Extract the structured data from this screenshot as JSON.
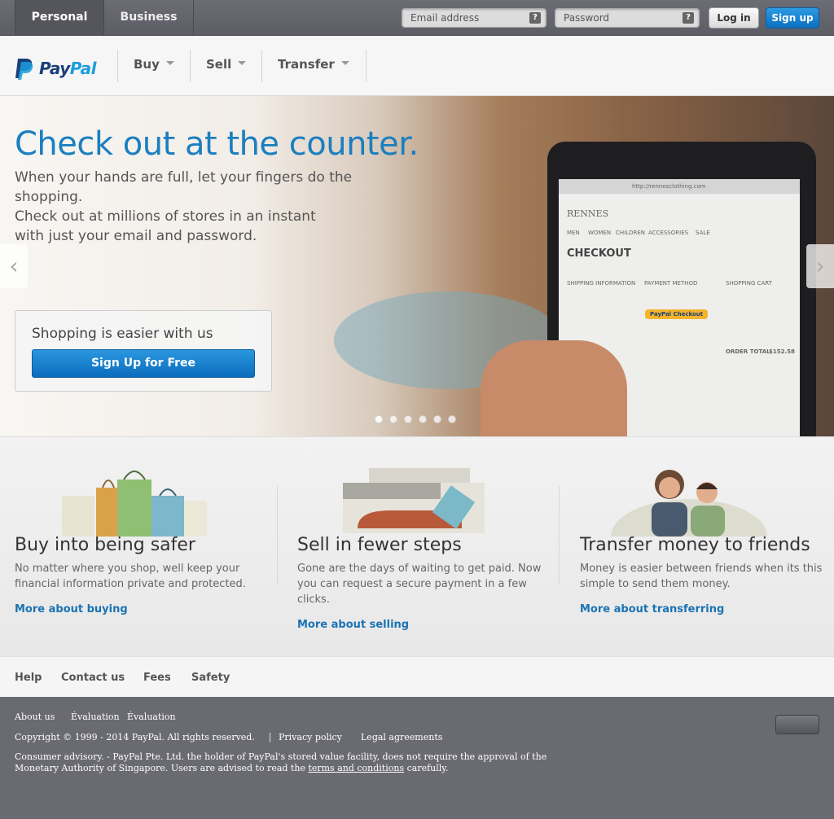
{
  "top": {
    "tabs": [
      "Personal",
      "Business"
    ],
    "email_placeholder": "Email address",
    "password_placeholder": "Password",
    "help_glyph": "?",
    "login": "Log in",
    "signup": "Sign up"
  },
  "nav": {
    "logo_pay": "Pay",
    "logo_pal": "Pal",
    "items": [
      "Buy",
      "Sell",
      "Transfer"
    ]
  },
  "hero": {
    "title": "Check out at the counter.",
    "text_line1": "When your hands are full, let your fingers do the shopping.",
    "text_line2": "Check out at millions of stores in an instant with just your email and password.",
    "promo_title": "Shopping is easier with us",
    "promo_button": "Sign Up for Free",
    "prev_glyph": "‹",
    "next_glyph": "›",
    "tablet": {
      "url": "http://rennesclothing.com",
      "store": "RENNES",
      "heading": "CHECKOUT",
      "nav": [
        "MEN",
        "WOMEN",
        "CHILDREN",
        "ACCESSORIES",
        "SALE"
      ],
      "columns": [
        "SHIPPING INFORMATION",
        "PAYMENT METHOD",
        "SHOPPING CART"
      ],
      "paypal_btn": "PayPal Checkout",
      "total": "ORDER TOTAL",
      "total_value": "$152.58"
    }
  },
  "features": [
    {
      "title": "Buy into being safer",
      "text": "No matter where you shop, well keep your financial information private and protected.",
      "link": "More about buying"
    },
    {
      "title": "Sell in fewer steps",
      "text": "Gone are the days of waiting to get paid. Now you can request a secure payment in a few clicks.",
      "link": "More about selling"
    },
    {
      "title": "Transfer money to friends",
      "text": "Money is easier between friends when its this simple to send them money.",
      "link": "More about transferring"
    }
  ],
  "footer_links": [
    "Help",
    "Contact us",
    "Fees",
    "Safety"
  ],
  "footer": {
    "about": "About us",
    "eval1": "Évaluation",
    "eval2": "Évaluation",
    "copyright": "Copyright © 1999 - 2014 PayPal. All rights reserved.",
    "privacy": "Privacy policy",
    "legal": "Legal agreements",
    "consumer_pre": "Consumer advisory. - PayPal Pte. Ltd. the holder of PayPal's stored value facility, does not require the approval of the Monetary Authority of Singapore. Users are advised to read the",
    "consumer_link": "terms and conditions",
    "consumer_post": "carefully."
  },
  "colors": {
    "brand_blue": "#1b7fbf",
    "button_blue": "#0a6fbf",
    "footer_gray": "#6a6a72"
  }
}
